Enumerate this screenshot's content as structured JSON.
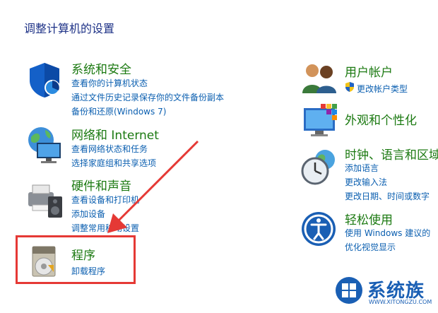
{
  "page": {
    "title": "调整计算机的设置"
  },
  "categories": {
    "system": {
      "title": "系统和安全",
      "links": [
        "查看你的计算机状态",
        "通过文件历史记录保存你的文件备份副本",
        "备份和还原(Windows 7)"
      ]
    },
    "network": {
      "title": "网络和 Internet",
      "links": [
        "查看网络状态和任务",
        "选择家庭组和共享选项"
      ]
    },
    "hardware": {
      "title": "硬件和声音",
      "links": [
        "查看设备和打印机",
        "添加设备",
        "调整常用移动设置"
      ]
    },
    "programs": {
      "title": "程序",
      "links": [
        "卸载程序"
      ]
    },
    "users": {
      "title": "用户帐户",
      "links": [
        "更改帐户类型"
      ]
    },
    "appearance": {
      "title": "外观和个性化",
      "links": []
    },
    "clock": {
      "title": "时钟、语言和区域",
      "links": [
        "添加语言",
        "更改输入法",
        "更改日期、时间或数字"
      ]
    },
    "ease": {
      "title": "轻松使用",
      "links": [
        "使用 Windows 建议的",
        "优化视觉显示"
      ]
    }
  },
  "annotation": {
    "highlight_color": "#e53935"
  },
  "watermark": {
    "brand": "系统族",
    "url": "WWW.XITONGZU.COM"
  }
}
